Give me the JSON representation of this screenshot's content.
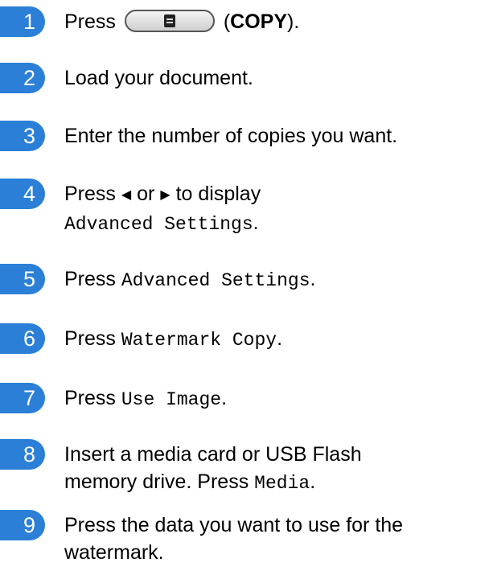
{
  "steps": [
    {
      "n": "1",
      "t1": "Press",
      "t2": "(",
      "t3": "COPY",
      "t4": ")."
    },
    {
      "n": "2",
      "t1": "Load your document."
    },
    {
      "n": "3",
      "t1": "Enter the number of copies you want."
    },
    {
      "n": "4",
      "t1": "Press",
      "a1": "◀",
      "t2": "or",
      "a2": "▶",
      "t3": "to display",
      "m1": "Advanced Settings",
      "t4": "."
    },
    {
      "n": "5",
      "t1": "Press",
      "m1": "Advanced Settings",
      "t2": "."
    },
    {
      "n": "6",
      "t1": "Press",
      "m1": "Watermark Copy",
      "t2": "."
    },
    {
      "n": "7",
      "t1": "Press",
      "m1": "Use Image",
      "t2": "."
    },
    {
      "n": "8",
      "t1": "Insert a media card or USB Flash",
      "t2": "memory drive. Press",
      "m1": "Media",
      "t3": "."
    },
    {
      "n": "9",
      "t1": "Press the data you want to use for the",
      "t2": "watermark."
    }
  ],
  "icons": {
    "copy_button": "copy-document-icon",
    "left_arrow": "left-arrow-icon",
    "right_arrow": "right-arrow-icon"
  },
  "colors": {
    "step_badge": "#2b7fd6"
  }
}
